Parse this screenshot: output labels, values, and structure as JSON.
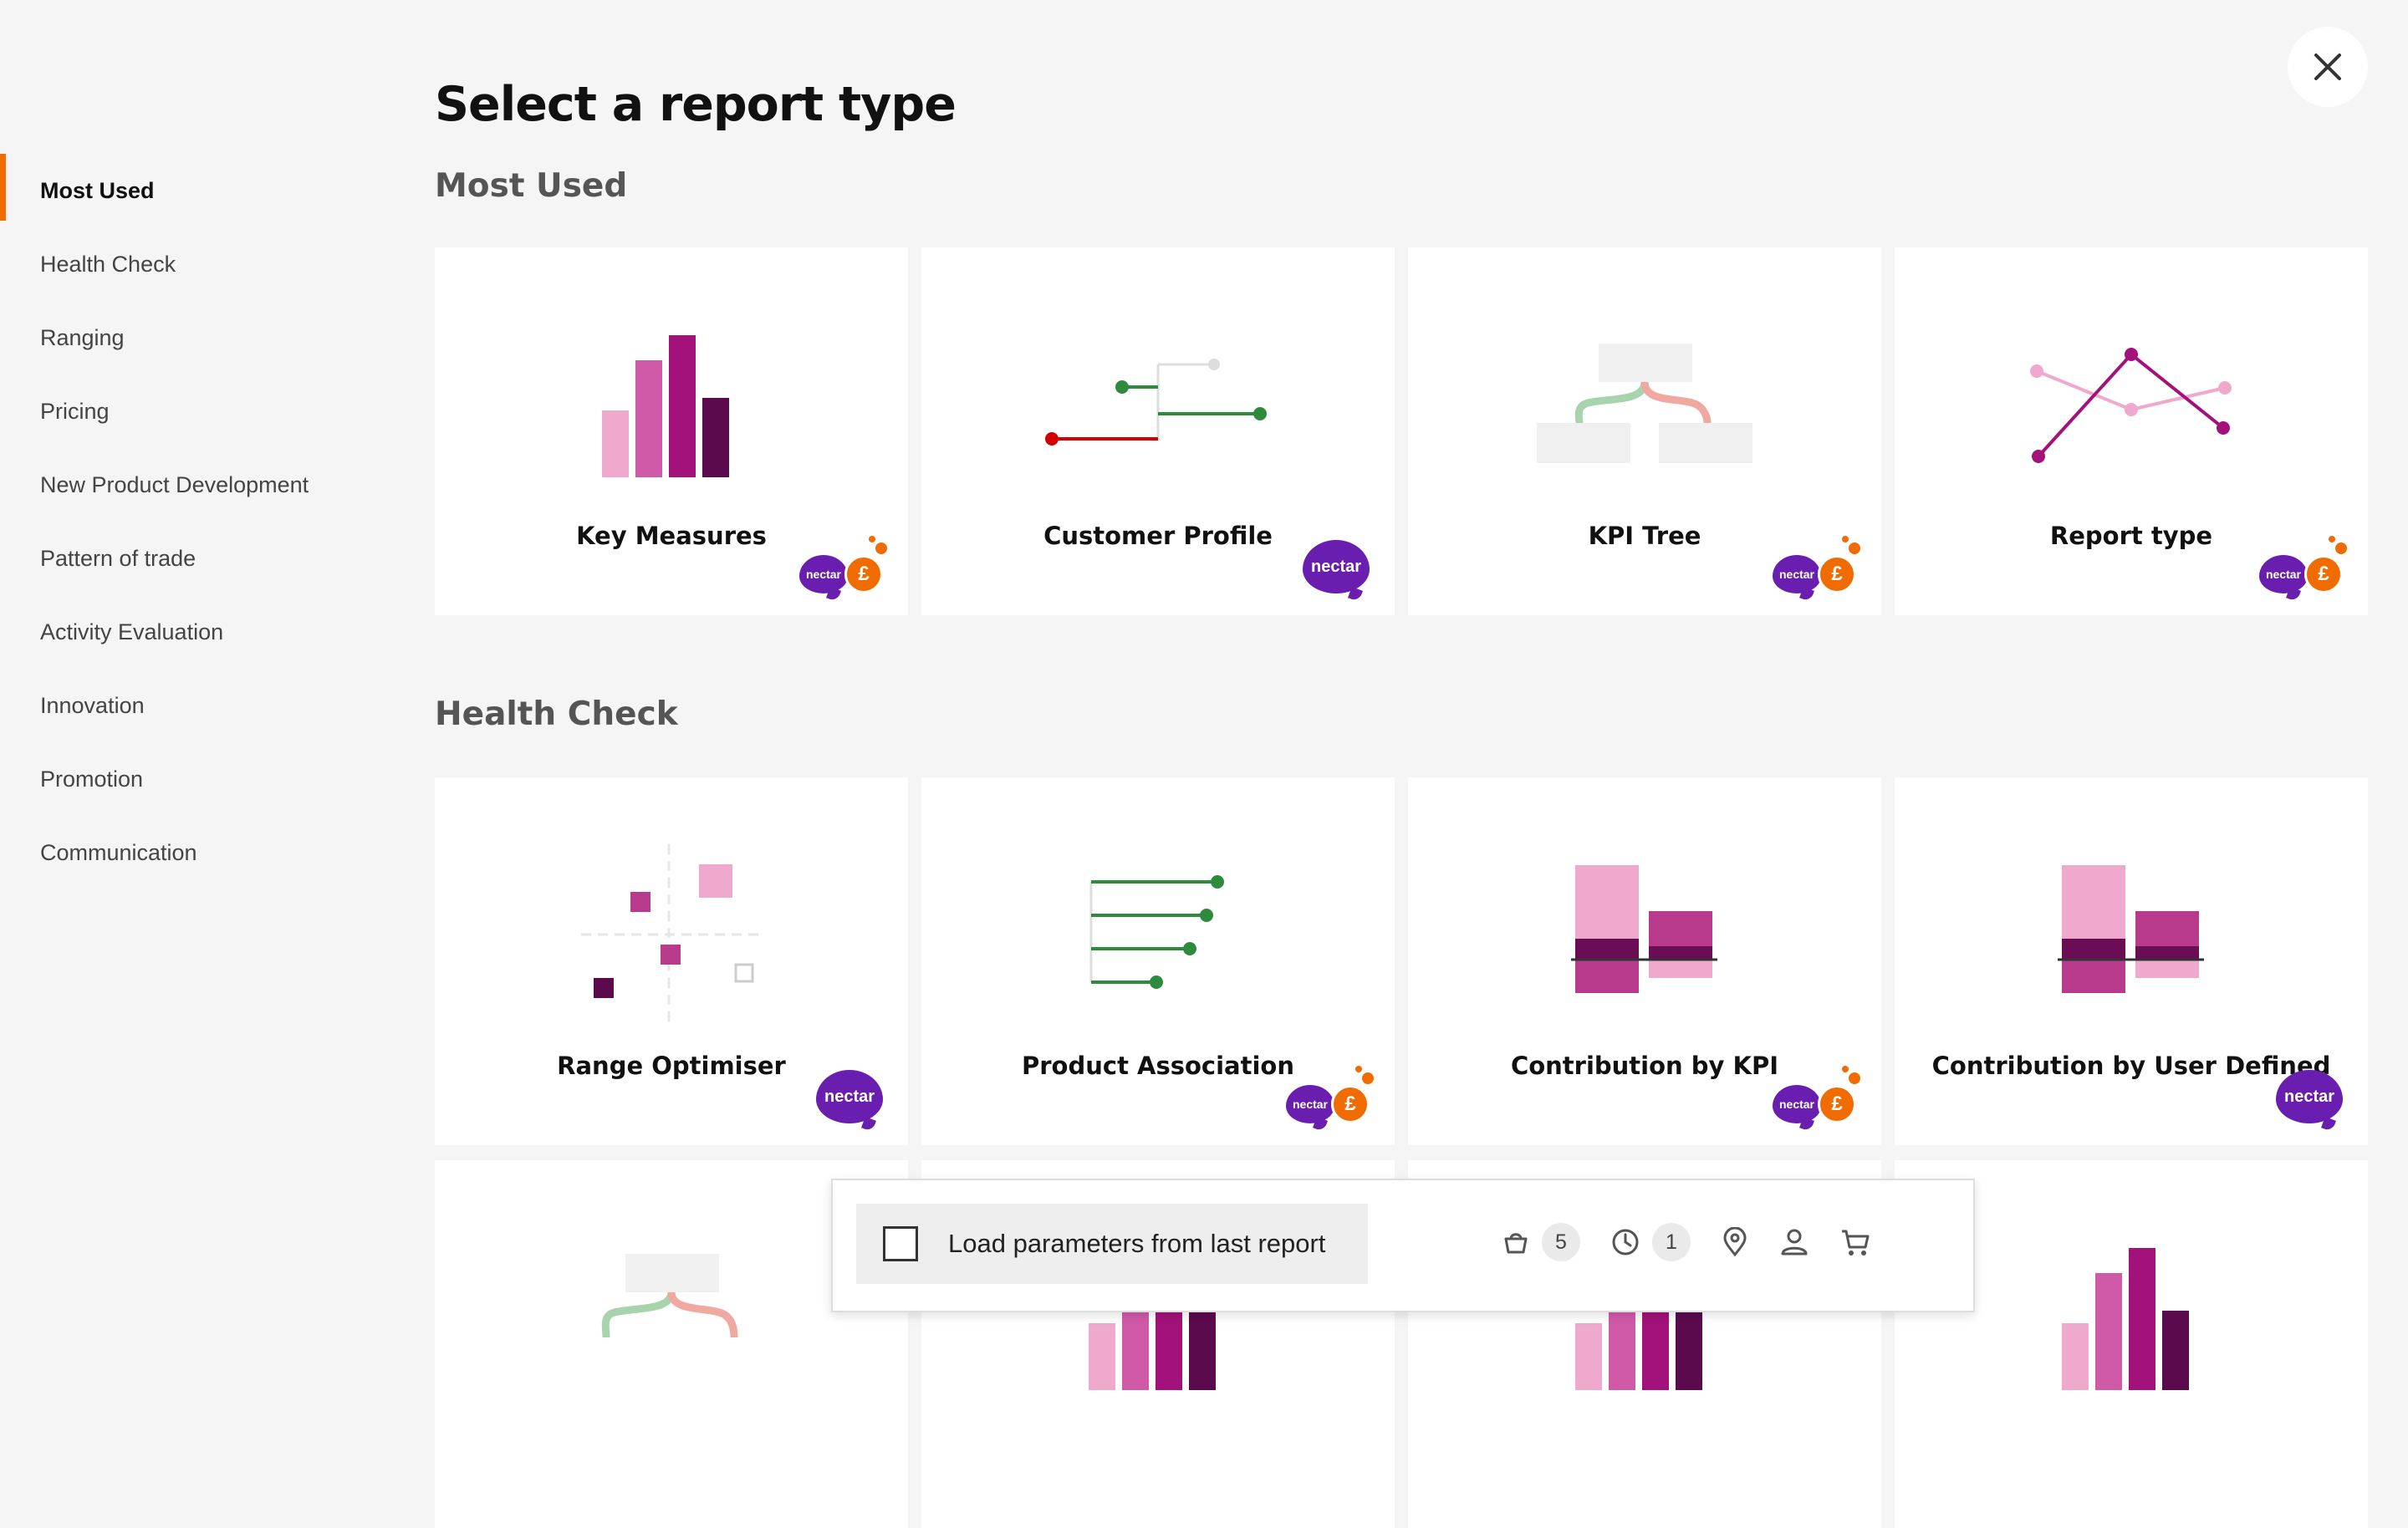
{
  "page": {
    "title": "Select a report type"
  },
  "close": {
    "icon": "close-icon"
  },
  "sidebar": {
    "items": [
      {
        "label": "Most Used",
        "active": true
      },
      {
        "label": "Health Check"
      },
      {
        "label": "Ranging"
      },
      {
        "label": "Pricing"
      },
      {
        "label": "New Product Development"
      },
      {
        "label": "Pattern of trade"
      },
      {
        "label": "Activity Evaluation"
      },
      {
        "label": "Innovation"
      },
      {
        "label": "Promotion"
      },
      {
        "label": "Communication"
      }
    ]
  },
  "sections": {
    "most_used": {
      "title": "Most Used",
      "cards": [
        {
          "label": "Key Measures",
          "badges": [
            "nectar",
            "pound"
          ]
        },
        {
          "label": "Customer Profile",
          "badges": [
            "nectar"
          ]
        },
        {
          "label": "KPI Tree",
          "badges": [
            "nectar",
            "pound"
          ]
        },
        {
          "label": "Report type",
          "badges": [
            "nectar",
            "pound"
          ]
        }
      ]
    },
    "health_check": {
      "title": "Health Check",
      "cards": [
        {
          "label": "Range Optimiser",
          "badges": [
            "nectar"
          ]
        },
        {
          "label": "Product Association",
          "badges": [
            "nectar",
            "pound"
          ]
        },
        {
          "label": "Contribution by KPI",
          "badges": [
            "nectar",
            "pound"
          ]
        },
        {
          "label": "Contribution by User Defined",
          "badges": [
            "nectar"
          ]
        }
      ]
    }
  },
  "badges": {
    "nectar_text": "nectar",
    "pound_text": "£"
  },
  "bottom_bar": {
    "load_label": "Load parameters from last report",
    "checked": false,
    "basket_count": "5",
    "time_count": "1"
  },
  "colors": {
    "accent": "#f06c00",
    "nectar_purple": "#6a1eaf",
    "magenta": "#a3127a",
    "green": "#2e8b3d",
    "red": "#d40000"
  }
}
